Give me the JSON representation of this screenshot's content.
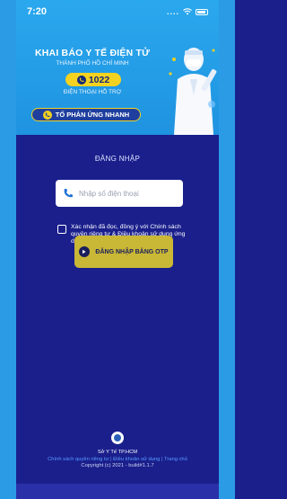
{
  "status_bar": {
    "time": "7:20",
    "signal": "...."
  },
  "banner": {
    "title": "KHAI BÁO Y TẾ ĐIỆN TỬ",
    "city": "THÀNH PHỐ HỒ CHÍ MINH",
    "hotline": "1022",
    "support_label": "ĐIỆN THOẠI HỖ TRỢ",
    "reaction_button": "TỐ PHẢN ỨNG NHANH"
  },
  "login": {
    "title": "ĐĂNG NHẬP",
    "phone_placeholder": "Nhập số điện thoại",
    "consent_text": "Xác nhận đã đọc, đồng ý với Chính sách quyền riêng tư & Điều khoản sử dụng ứng dụng",
    "otp_button": "ĐĂNG NHẬP BẰNG OTP"
  },
  "footer": {
    "org": "Sở Y Tế TP.HCM",
    "links": "Chính sách quyền riêng tư | Điều khoản sử dụng | Trang chủ",
    "copyright": "Copyright (c) 2021 - build#1.1.7"
  },
  "colors": {
    "background": "#1a1f8c",
    "banner": "#2aa8ee",
    "accent_yellow": "#f4d21f",
    "otp_button": "#c9b736"
  }
}
